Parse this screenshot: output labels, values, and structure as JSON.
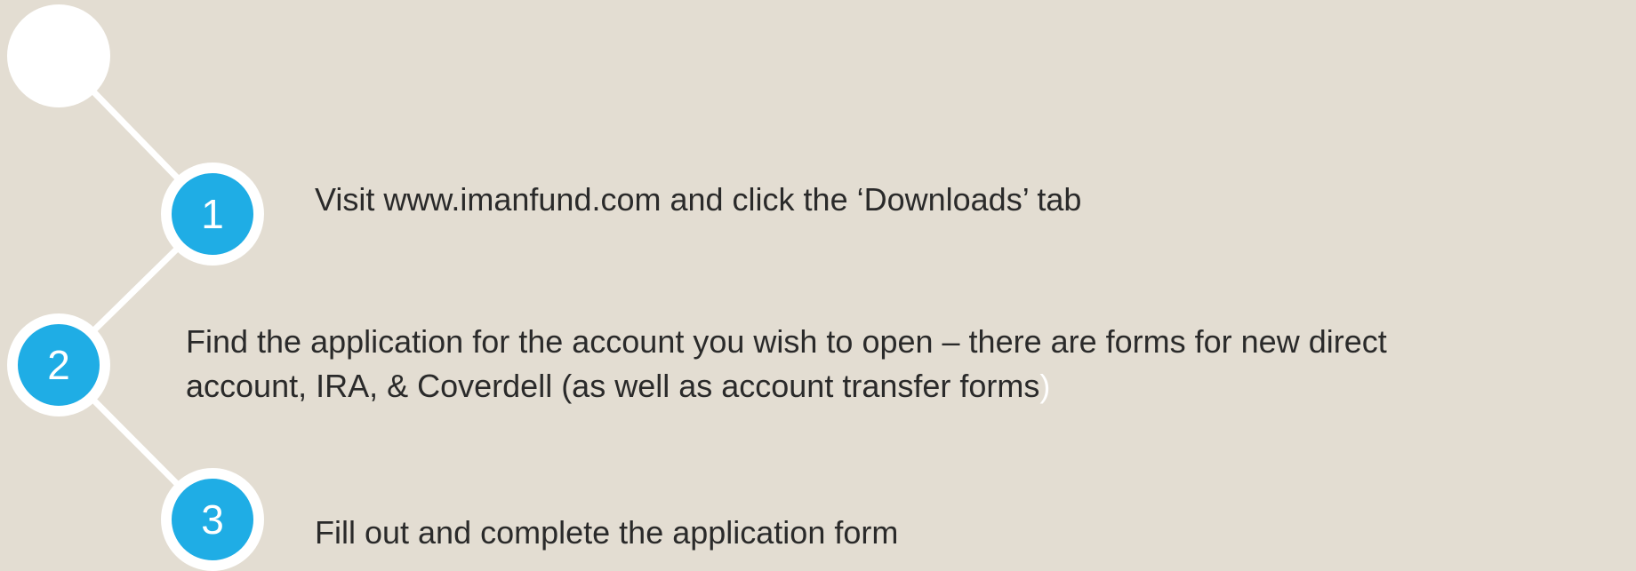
{
  "colors": {
    "background": "#e3ddd2",
    "badge_fill": "#1fade5",
    "badge_ring": "#ffffff",
    "connector": "#ffffff",
    "text": "#2a2a2a"
  },
  "steps": [
    {
      "number": "1",
      "text": "Visit www.imanfund.com and click the ‘Downloads’ tab"
    },
    {
      "number": "2",
      "line1": "Find the application for the account you wish to open – there are forms for new direct",
      "line2": "account, IRA,  & Coverdell (as well as account transfer forms",
      "line2_end": ")"
    },
    {
      "number": "3",
      "text": "Fill out and complete the application form"
    }
  ]
}
